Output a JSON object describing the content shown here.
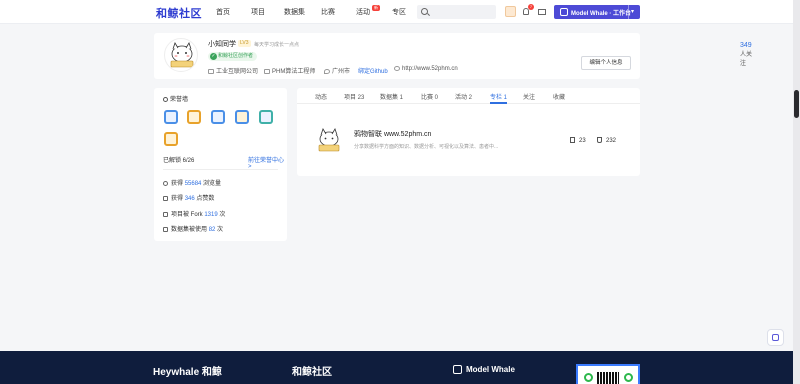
{
  "nav": {
    "logo": "和鲸社区",
    "items": [
      {
        "label": "首页"
      },
      {
        "label": "项目"
      },
      {
        "label": "数据集"
      },
      {
        "label": "比赛"
      },
      {
        "label": "活动"
      },
      {
        "label": "专区"
      }
    ],
    "activity_badge": "新",
    "search_placeholder": "",
    "notification_count": "7",
    "modelwhale_label": "Model Whale · 工作台"
  },
  "profile": {
    "username": "小知同学",
    "level": "LV3",
    "motto": "每天学习成长一点点",
    "creator_badge": "和鲸社区创作者",
    "company": "工业互联网公司",
    "position": "PHM算法工程师",
    "city": "广州市",
    "github": "绑定Github",
    "website": "http://www.52phm.cn",
    "followers_count": "349",
    "followers_label": "人关注",
    "edit_button": "编辑个人信息"
  },
  "honor": {
    "title": "荣誉墙",
    "unlocked": "已解锁 6/26",
    "link": "前往荣誉中心>",
    "medal_colors": [
      "#4a8fe7",
      "#e8a22a",
      "#4a8fe7",
      "#4a8fe7",
      "#3fb0a8",
      "#e8a22a"
    ],
    "stats": [
      {
        "prefix": "获得",
        "value": "55684",
        "suffix": "浏览量"
      },
      {
        "prefix": "获得",
        "value": "346",
        "suffix": "点赞数"
      },
      {
        "prefix": "项目被 Fork",
        "value": "1319",
        "suffix": "次"
      },
      {
        "prefix": "数据集被使用",
        "value": "82",
        "suffix": "次"
      }
    ]
  },
  "tabs": [
    {
      "label": "动态",
      "active": false
    },
    {
      "label": "项目 23",
      "active": false
    },
    {
      "label": "数据集 1",
      "active": false
    },
    {
      "label": "比赛 0",
      "active": false
    },
    {
      "label": "活动 2",
      "active": false
    },
    {
      "label": "专栏 1",
      "active": true
    },
    {
      "label": "关注",
      "active": false
    },
    {
      "label": "收藏",
      "active": false
    }
  ],
  "column": {
    "title": "鸦物智联 www.52phm.cn",
    "description": "分享数据科学方面的知识、数据分析、可视化以及算法、患者中...",
    "articles": "23",
    "subscribers": "232"
  },
  "footer": {
    "brand1": "Heywhale 和鲸",
    "brand2": "和鲸社区",
    "brand3": "Model Whale"
  },
  "colors": {
    "accent": "#2f6fe0",
    "brand": "#4d4ad6",
    "footer_bg": "#0f1d3d"
  }
}
